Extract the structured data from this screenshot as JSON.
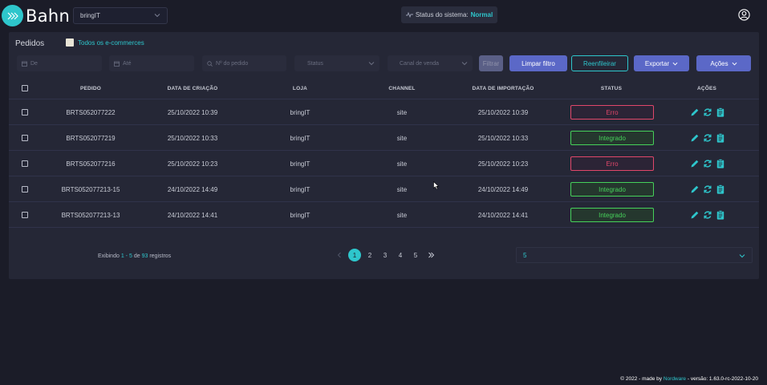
{
  "header": {
    "logo_text": "Bahn",
    "store_select_value": "bringIT",
    "system_status_label": "Status do sistema:",
    "system_status_value": "Normal"
  },
  "panel": {
    "title": "Pedidos",
    "ecommerce_checkbox_label": "Todos os e-commerces"
  },
  "filters": {
    "date_from_placeholder": "De",
    "date_to_placeholder": "Até",
    "order_number_placeholder": "Nº do pedido",
    "status_placeholder": "Status",
    "channel_placeholder": "Canal de venda",
    "filter_button": "Filtrar",
    "clear_button": "Limpar filtro",
    "requeue_button": "Reenfileirar",
    "export_button": "Exportar",
    "actions_button": "Ações"
  },
  "table": {
    "columns": [
      "PEDIDO",
      "DATA DE CRIAÇÃO",
      "LOJA",
      "CHANNEL",
      "DATA DE IMPORTAÇÃO",
      "STATUS",
      "AÇÕES"
    ],
    "rows": [
      {
        "pedido": "BRTS052077222",
        "criacao": "25/10/2022 10:39",
        "loja": "bringIT",
        "channel": "site",
        "importacao": "25/10/2022 10:39",
        "status": "Erro",
        "status_type": "error"
      },
      {
        "pedido": "BRTS052077219",
        "criacao": "25/10/2022 10:33",
        "loja": "bringIT",
        "channel": "site",
        "importacao": "25/10/2022 10:33",
        "status": "Integrado",
        "status_type": "ok"
      },
      {
        "pedido": "BRTS052077216",
        "criacao": "25/10/2022 10:23",
        "loja": "bringIT",
        "channel": "site",
        "importacao": "25/10/2022 10:23",
        "status": "Erro",
        "status_type": "error"
      },
      {
        "pedido": "BRTS052077213-15",
        "criacao": "24/10/2022 14:49",
        "loja": "bringIT",
        "channel": "site",
        "importacao": "24/10/2022 14:49",
        "status": "Integrado",
        "status_type": "ok"
      },
      {
        "pedido": "BRTS052077213-13",
        "criacao": "24/10/2022 14:41",
        "loja": "bringIT",
        "channel": "site",
        "importacao": "24/10/2022 14:41",
        "status": "Integrado",
        "status_type": "ok"
      }
    ]
  },
  "pagination": {
    "showing_prefix": "Exibindo",
    "showing_from": "1",
    "showing_sep": "-",
    "showing_to": "5",
    "showing_of": "de",
    "showing_total": "93",
    "showing_suffix": "registros",
    "pages": [
      "1",
      "2",
      "3",
      "4",
      "5"
    ],
    "active_page": "1",
    "per_page": "5"
  },
  "footer": {
    "prefix": "© 2022 - made by",
    "company": "Nordware",
    "version": "- versão: 1.63.0-rc-2022-10-20"
  },
  "colors": {
    "accent": "#2ec6cc",
    "primary_button": "#5b68c7",
    "error": "#e0476a",
    "success": "#46d15a",
    "background": "#1b1c28",
    "panel": "#252736"
  },
  "icons": {
    "logo": "chevrons-right-icon",
    "edit": "pencil-icon",
    "resync": "refresh-icon",
    "details": "clipboard-icon",
    "user": "user-circle-icon"
  }
}
